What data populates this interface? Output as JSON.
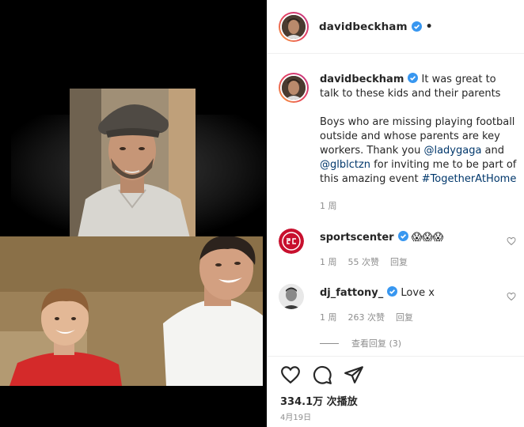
{
  "post": {
    "username": "davidbeckham",
    "header_dot": "•",
    "caption": {
      "username": "davidbeckham",
      "line1": "It was great to talk to these kids and their parents",
      "para_prefix": "Boys who are missing playing football outside and whose parents are key workers. Thank you ",
      "mention1": "@ladygaga",
      "and_text": " and ",
      "mention2": "@glblctzn",
      "mid_text": " for inviting me to be part of this amazing event ",
      "hashtag": "#TogetherAtHome",
      "time_ago": "1 周"
    },
    "comments": [
      {
        "username": "sportscenter",
        "text": "😱😱😱",
        "time": "1 周",
        "likes": "55 次赞",
        "reply": "回复"
      },
      {
        "username": "dj_fattony_",
        "text": "Love x",
        "time": "1 周",
        "likes": "263 次赞",
        "reply": "回复"
      }
    ],
    "view_replies": "查看回复 (3)",
    "views": "334.1万 次播放",
    "date": "4月19日"
  },
  "icons": {
    "like": "heart-icon",
    "comment": "comment-bubble-icon",
    "share": "paper-plane-icon",
    "verified": "verified-badge-icon"
  },
  "colors": {
    "verified": "#3897f0",
    "link": "#00376b",
    "muted": "#8e8e8e",
    "sportscenter_red": "#c8102e"
  }
}
